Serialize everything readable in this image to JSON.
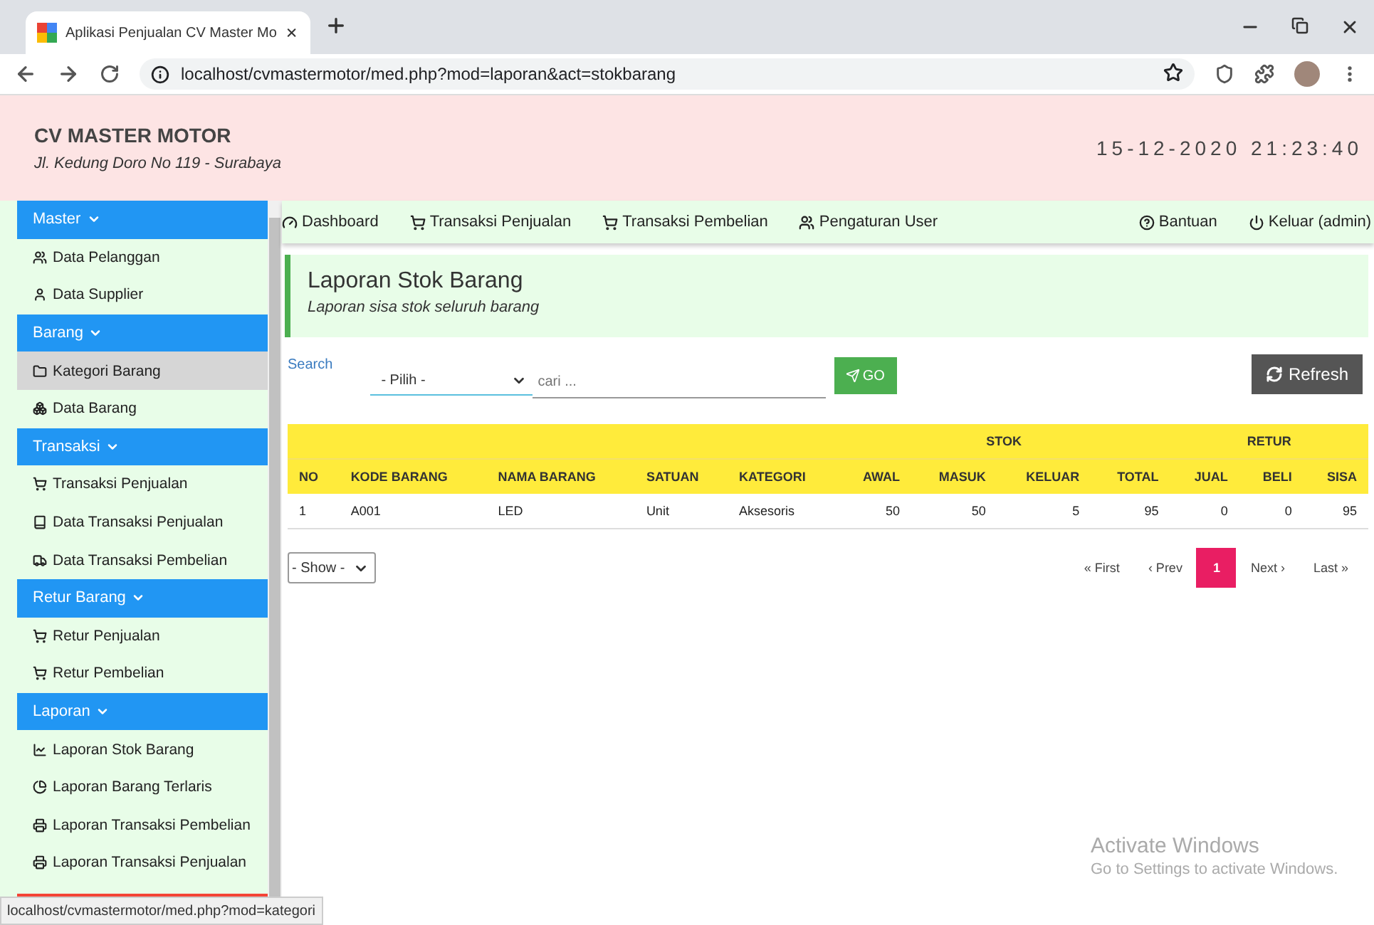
{
  "browser": {
    "tab_title": "Aplikasi Penjualan CV Master Mo",
    "url": "localhost/cvmastermotor/med.php?mod=laporan&act=stokbarang",
    "status_url": "localhost/cvmastermotor/med.php?mod=kategori"
  },
  "header": {
    "company": "CV MASTER MOTOR",
    "address": "Jl. Kedung Doro No 119 - Surabaya",
    "datetime": "15-12-2020 21:23:40"
  },
  "sidebar": {
    "sections": [
      {
        "title": "Master",
        "items": [
          {
            "label": "Data Pelanggan",
            "selected": false
          },
          {
            "label": "Data Supplier",
            "selected": false
          }
        ]
      },
      {
        "title": "Barang",
        "items": [
          {
            "label": "Kategori Barang",
            "selected": true
          },
          {
            "label": "Data Barang",
            "selected": false
          }
        ]
      },
      {
        "title": "Transaksi",
        "items": [
          {
            "label": "Transaksi Penjualan",
            "selected": false
          },
          {
            "label": "Data Transaksi Penjualan",
            "selected": false
          },
          {
            "label": "Data Transaksi Pembelian",
            "selected": false
          }
        ]
      },
      {
        "title": "Retur Barang",
        "items": [
          {
            "label": "Retur Penjualan",
            "selected": false
          },
          {
            "label": "Retur Pembelian",
            "selected": false
          }
        ]
      },
      {
        "title": "Laporan",
        "items": [
          {
            "label": "Laporan Stok Barang",
            "selected": false
          },
          {
            "label": "Laporan Barang Terlaris",
            "selected": false
          },
          {
            "label": "Laporan Transaksi Pembelian",
            "selected": false
          },
          {
            "label": "Laporan Transaksi Penjualan",
            "selected": false
          }
        ]
      }
    ]
  },
  "navbar": {
    "left": [
      "Dashboard",
      "Transaksi Penjualan",
      "Transaksi Pembelian",
      "Pengaturan User"
    ],
    "right": [
      "Bantuan",
      "Keluar (admin)"
    ]
  },
  "page": {
    "title": "Laporan Stok Barang",
    "subtitle": "Laporan sisa stok seluruh barang"
  },
  "search": {
    "label": "Search",
    "select_value": "- Pilih -",
    "placeholder": "cari ...",
    "go_button": "GO",
    "refresh_button": "Refresh"
  },
  "table": {
    "header": [
      {
        "columns": [
          {
            "label": "NO",
            "kind": "text"
          },
          {
            "label": "KODE BARANG",
            "kind": "text"
          },
          {
            "label": "NAMA BARANG",
            "kind": "text"
          },
          {
            "label": "SATUAN",
            "kind": "text"
          },
          {
            "label": "KATEGORI",
            "kind": "text"
          }
        ]
      },
      {
        "label": "STOK",
        "columns": [
          {
            "label": "AWAL",
            "kind": "number"
          },
          {
            "label": "MASUK",
            "kind": "number"
          },
          {
            "label": "KELUAR",
            "kind": "number"
          },
          {
            "label": "TOTAL",
            "kind": "number"
          }
        ]
      },
      {
        "label": "RETUR",
        "columns": [
          {
            "label": "JUAL",
            "kind": "number"
          },
          {
            "label": "BELI",
            "kind": "number"
          },
          {
            "label": "SISA",
            "kind": "number"
          }
        ]
      }
    ],
    "rows": [
      [
        "1",
        "A001",
        "LED",
        "Unit",
        "Aksesoris",
        "50",
        "50",
        "5",
        "95",
        "0",
        "0",
        "95"
      ]
    ]
  },
  "show_select": "- Show -",
  "pagination": [
    {
      "label": "« First",
      "kind": "nav",
      "selected": false
    },
    {
      "label": "‹ Prev",
      "kind": "nav",
      "selected": false
    },
    {
      "label": "1",
      "kind": "page",
      "selected": true
    },
    {
      "label": "Next ›",
      "kind": "nav",
      "selected": false
    },
    {
      "label": "Last »",
      "kind": "nav",
      "selected": false
    }
  ],
  "os_overlay": {
    "title": "Activate Windows",
    "subtitle": "Go to Settings to activate Windows."
  }
}
